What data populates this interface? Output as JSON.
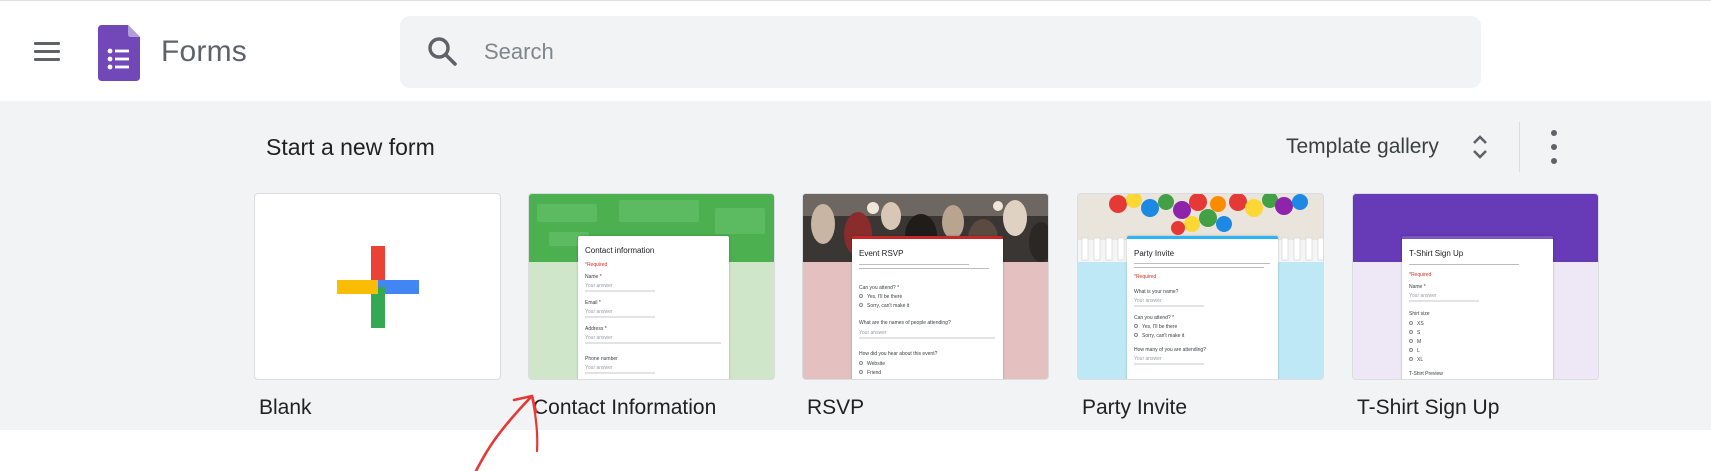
{
  "header": {
    "app_title": "Forms",
    "search_placeholder": "Search"
  },
  "start_section": {
    "title": "Start a new form",
    "gallery_label": "Template gallery"
  },
  "templates": [
    {
      "label": "Blank"
    },
    {
      "label": "Contact Information",
      "form_title": "Contact information",
      "required": "*Required",
      "fields": [
        "Name *",
        "Email *",
        "Address *",
        "Phone number"
      ],
      "answer_placeholder": "Your answer",
      "header_color": "#4caf50",
      "body_color": "#cfe7c8"
    },
    {
      "label": "RSVP",
      "form_title": "Event RSVP",
      "questions": [
        "Can you attend? *",
        "What are the names of people attending?",
        "How did you hear about this event?"
      ],
      "options": [
        "Yes, I'll be there",
        "Sorry, can't make it",
        "Website",
        "Friend"
      ],
      "answer_placeholder": "Your answer",
      "body_color": "#e4c0c1"
    },
    {
      "label": "Party Invite",
      "form_title": "Party Invite",
      "required": "*Required",
      "questions": [
        "What is your name?",
        "Can you attend? *",
        "How many of you are attending?"
      ],
      "options": [
        "Yes, I'll be there",
        "Sorry, can't make it"
      ],
      "answer_placeholder": "Your answer",
      "body_color": "#bfe8f7"
    },
    {
      "label": "T-Shirt Sign Up",
      "form_title": "T-Shirt Sign Up",
      "required": "*Required",
      "name_field": "Name *",
      "size_label": "Shirt size",
      "sizes": [
        "XS",
        "S",
        "M",
        "L",
        "XL"
      ],
      "preview_label": "T-Shirt Preview",
      "answer_placeholder": "Your answer",
      "header_color": "#673ab7",
      "body_color": "#ede7f6"
    }
  ],
  "colors": {
    "forms_purple": "#7248b9",
    "plus_red": "#ea4335",
    "plus_blue": "#4285f4",
    "plus_green": "#34a853",
    "plus_yellow": "#fbbc04",
    "annotation": "#e53935"
  }
}
